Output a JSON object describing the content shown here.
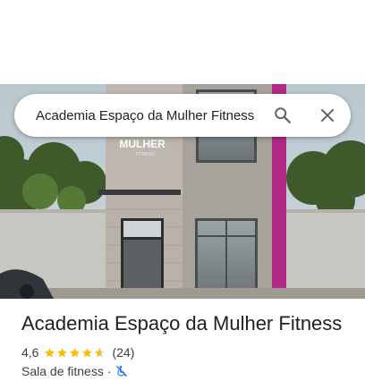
{
  "search": {
    "value": "Academia Espaço da Mulher Fitness",
    "search_icon": "search-icon",
    "close_icon": "close-icon"
  },
  "photo": {
    "sign_main": "MULHER",
    "sign_sub": "FITNESS",
    "accent_color": "#b02a86"
  },
  "place": {
    "name": "Academia Espaço da Mulher Fitness",
    "rating": "4,6",
    "stars": 4.6,
    "review_count": "(24)",
    "category": "Sala de fitness",
    "separator": "·",
    "accessibility_icon": "not-wheelchair-accessible-icon",
    "star_color": "#fbbc04",
    "accessibility_color": "#1a73e8"
  }
}
